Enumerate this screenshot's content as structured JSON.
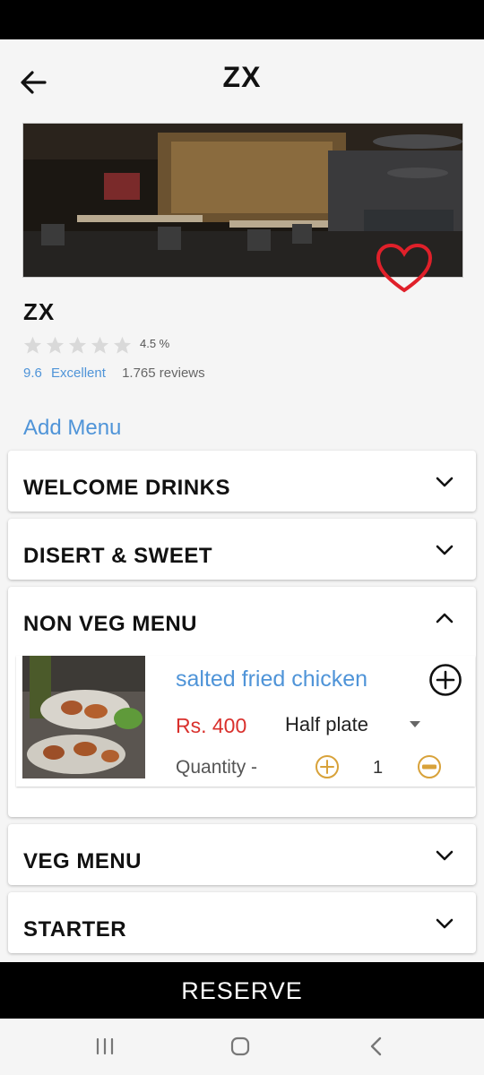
{
  "header": {
    "title": "ZX"
  },
  "restaurant": {
    "name": "ZX",
    "rating_percent": "4.5 %",
    "score": "9.6",
    "score_text": "Excellent",
    "reviews": "1.765 reviews",
    "star_rating": 0,
    "favorite": true
  },
  "add_menu_label": "Add Menu",
  "menu_sections": [
    {
      "title": "WELCOME DRINKS",
      "expanded": false
    },
    {
      "title": "DISERT & SWEET",
      "expanded": false
    },
    {
      "title": "NON VEG MENU",
      "expanded": true
    },
    {
      "title": "VEG MENU",
      "expanded": false
    },
    {
      "title": "STARTER",
      "expanded": false
    }
  ],
  "item": {
    "name": "salted fried chicken",
    "price": "Rs. 400",
    "portion": "Half plate",
    "quantity_label": "Quantity -",
    "quantity": "1"
  },
  "reserve_label": "RESERVE",
  "colors": {
    "accent": "#4f94d8",
    "price": "#d9302c",
    "qty_icon": "#d8a23a",
    "heart": "#e0202a"
  },
  "icons": [
    "back-arrow-icon",
    "heart-icon",
    "star-icon",
    "chevron-down-icon",
    "chevron-up-icon",
    "plus-circle-icon",
    "dropdown-arrow-icon",
    "minus-circle-icon",
    "recent-apps-icon",
    "home-icon",
    "back-icon"
  ]
}
